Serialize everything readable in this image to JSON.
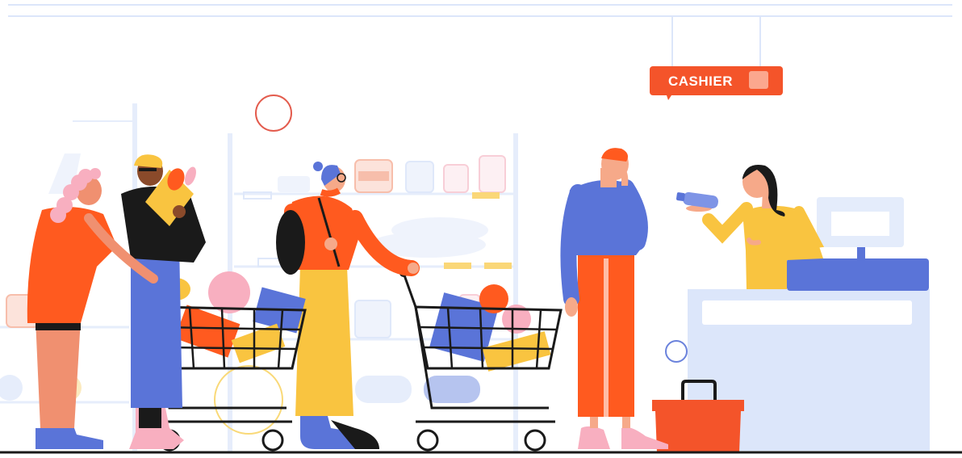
{
  "scene": {
    "signs": {
      "cashier_label": "CASHIER"
    },
    "colors": {
      "accent_orange": "#FF5A1F",
      "sign_orange": "#F4542A",
      "blue_shirt": "#5A74D8",
      "yellow": "#F9C440",
      "pink": "#F8AFC0",
      "shelf_blue": "#DCE6FA",
      "ink": "#1A1A1A"
    }
  }
}
